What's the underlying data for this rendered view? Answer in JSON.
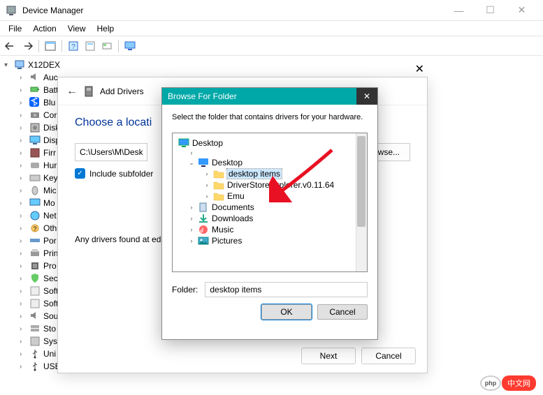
{
  "window": {
    "title": "Device Manager"
  },
  "menubar": {
    "items": [
      "File",
      "Action",
      "View",
      "Help"
    ]
  },
  "devtree": {
    "root": "X12DEX",
    "items": [
      {
        "label": "Auc",
        "icon": "sound"
      },
      {
        "label": "Batt",
        "icon": "battery"
      },
      {
        "label": "Blu",
        "icon": "bluetooth"
      },
      {
        "label": "Cor",
        "icon": "camera"
      },
      {
        "label": "Disk",
        "icon": "disk"
      },
      {
        "label": "Disp",
        "icon": "display"
      },
      {
        "label": "Firr",
        "icon": "firmware"
      },
      {
        "label": "Hur",
        "icon": "hid"
      },
      {
        "label": "Key",
        "icon": "keyboard"
      },
      {
        "label": "Mic",
        "icon": "mouse"
      },
      {
        "label": "Mo",
        "icon": "monitor"
      },
      {
        "label": "Net",
        "icon": "network"
      },
      {
        "label": "Oth",
        "icon": "other"
      },
      {
        "label": "Por",
        "icon": "port"
      },
      {
        "label": "Prin",
        "icon": "printer"
      },
      {
        "label": "Pro",
        "icon": "cpu"
      },
      {
        "label": "Sec",
        "icon": "security"
      },
      {
        "label": "Soft",
        "icon": "software"
      },
      {
        "label": "Soft",
        "icon": "software"
      },
      {
        "label": "Sou",
        "icon": "sound"
      },
      {
        "label": "Sto",
        "icon": "storage"
      },
      {
        "label": "Sys",
        "icon": "system"
      },
      {
        "label": "Uni",
        "icon": "usb"
      },
      {
        "label": "USE",
        "icon": "usb"
      }
    ]
  },
  "add_drivers": {
    "title": "Add Drivers",
    "heading": "Choose a locati",
    "path": "C:\\Users\\M\\Deskto",
    "browse_label": "wse...",
    "checkbox_label": "Include subfolder",
    "note": "Any drivers found at                                                                                                          ed on all applicable devices.",
    "next_label": "Next",
    "cancel_label": "Cancel"
  },
  "browse": {
    "title": "Browse For Folder",
    "instruction": "Select the folder that contains drivers for your hardware.",
    "tree": {
      "root": "Desktop",
      "desktop_expanded": "Desktop",
      "items": [
        {
          "label": "desktop items",
          "selected": true
        },
        {
          "label": "DriverStoreExplorer.v0.11.64"
        },
        {
          "label": "Emu"
        }
      ],
      "siblings": [
        {
          "label": "Documents",
          "icon": "doc"
        },
        {
          "label": "Downloads",
          "icon": "download"
        },
        {
          "label": "Music",
          "icon": "music"
        },
        {
          "label": "Pictures",
          "icon": "pictures"
        }
      ]
    },
    "folder_label": "Folder:",
    "folder_value": "desktop items",
    "ok_label": "OK",
    "cancel_label": "Cancel"
  },
  "watermark": {
    "text": "中文网",
    "php": "php"
  }
}
